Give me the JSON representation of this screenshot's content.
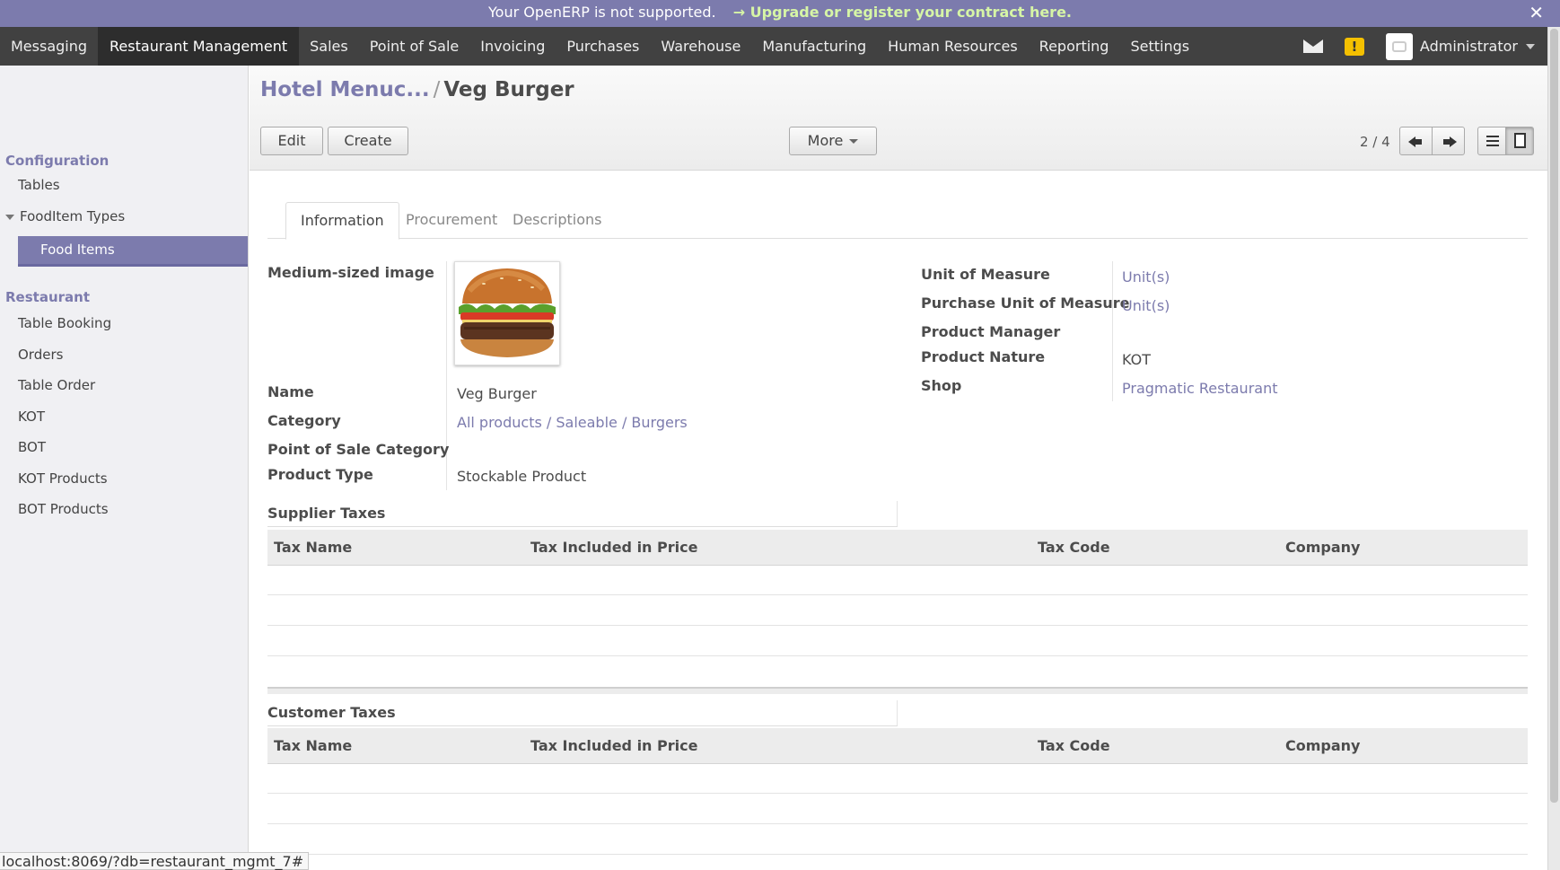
{
  "announcement": {
    "text": "Your OpenERP is not supported.",
    "link": "→ Upgrade or register your contract here.",
    "close": "✕"
  },
  "topnav": {
    "menus": [
      "Messaging",
      "Restaurant Management",
      "Sales",
      "Point of Sale",
      "Invoicing",
      "Purchases",
      "Warehouse",
      "Manufacturing",
      "Human Resources",
      "Reporting",
      "Settings"
    ],
    "active": "Restaurant Management",
    "warning_glyph": "!",
    "user": "Administrator"
  },
  "sidebar": {
    "configuration": "Configuration",
    "tables": "Tables",
    "fooditem_types": "FoodItem Types",
    "food_items": "Food Items",
    "restaurant": "Restaurant",
    "items": [
      "Table Booking",
      "Orders",
      "Table Order",
      "KOT",
      "BOT",
      "KOT Products",
      "BOT Products"
    ]
  },
  "breadcrumb": {
    "parent": "Hotel Menuc...",
    "separator": "/",
    "current": "Veg Burger"
  },
  "toolbar": {
    "edit": "Edit",
    "create": "Create",
    "more": "More",
    "pager": "2 / 4"
  },
  "tabs": [
    "Information",
    "Procurement",
    "Descriptions"
  ],
  "form": {
    "image_label": "Medium-sized image",
    "name_label": "Name",
    "name_value": "Veg Burger",
    "category_label": "Category",
    "category_value": "All products / Saleable / Burgers",
    "pos_category_label": "Point of Sale Category",
    "product_type_label": "Product Type",
    "product_type_value": "Stockable Product",
    "uom_label": "Unit of Measure",
    "uom_value": "Unit(s)",
    "purchase_uom_label": "Purchase Unit of Measure",
    "purchase_uom_value": "Unit(s)",
    "product_manager_label": "Product Manager",
    "product_nature_label": "Product Nature",
    "product_nature_value": "KOT",
    "shop_label": "Shop",
    "shop_value": "Pragmatic Restaurant"
  },
  "supplier_taxes": {
    "title": "Supplier Taxes",
    "columns": [
      "Tax Name",
      "Tax Included in Price",
      "Tax Code",
      "Company"
    ]
  },
  "customer_taxes": {
    "title": "Customer Taxes",
    "columns": [
      "Tax Name",
      "Tax Included in Price",
      "Tax Code",
      "Company"
    ]
  },
  "statusbar": "localhost:8069/?db=restaurant_mgmt_7#"
}
